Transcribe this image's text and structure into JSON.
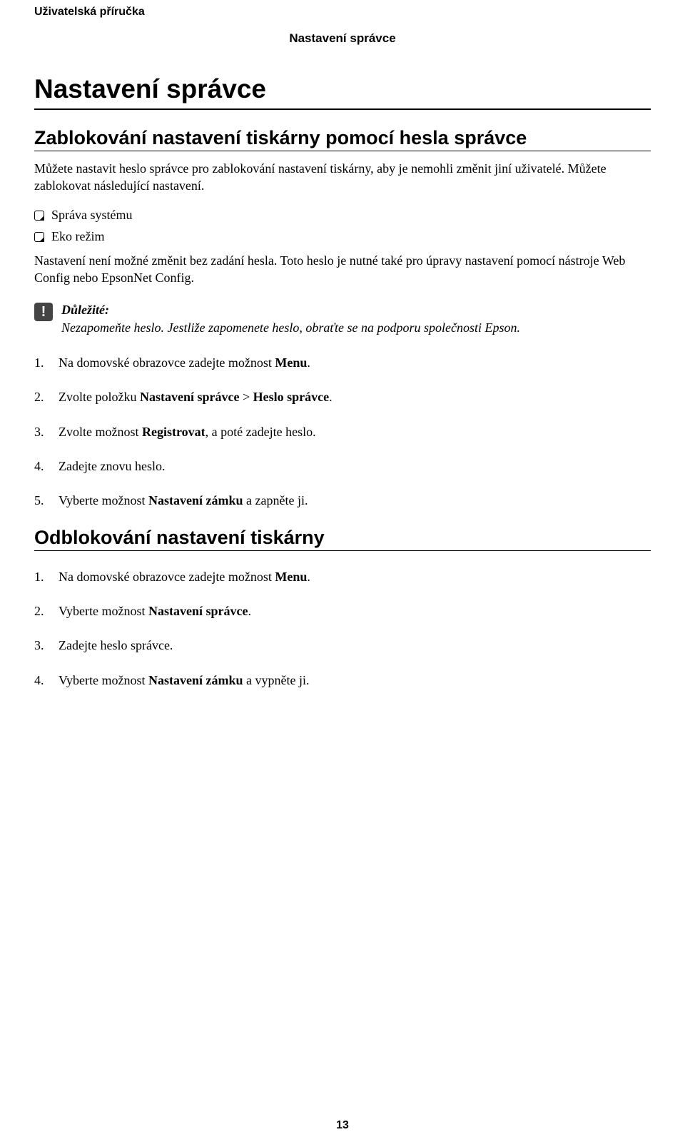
{
  "doc_title": "Uživatelská příručka",
  "breadcrumb": "Nastavení správce",
  "h1": "Nastavení správce",
  "section_lock": {
    "heading": "Zablokování nastavení tiskárny pomocí hesla správce",
    "intro": "Můžete nastavit heslo správce pro zablokování nastavení tiskárny, aby je nemohli změnit jiní uživatelé. Můžete zablokovat následující nastavení.",
    "bullets": [
      "Správa systému",
      "Eko režim"
    ],
    "after_bullets": "Nastavení není možné změnit bez zadání hesla. Toto heslo je nutné také pro úpravy nastavení pomocí nástroje Web Config nebo EpsonNet Config.",
    "important_label": "Důležité:",
    "important_text": "Nezapomeňte heslo. Jestliže zapomenete heslo, obraťte se na podporu společnosti Epson.",
    "steps": [
      {
        "pre": "Na domovské obrazovce zadejte možnost ",
        "b1": "Menu",
        "post": "."
      },
      {
        "pre": "Zvolte položku ",
        "b1": "Nastavení správce",
        "mid": " > ",
        "b2": "Heslo správce",
        "post": "."
      },
      {
        "pre": "Zvolte možnost ",
        "b1": "Registrovat",
        "post": ", a poté zadejte heslo."
      },
      {
        "pre": "Zadejte znovu heslo.",
        "b1": "",
        "post": ""
      },
      {
        "pre": "Vyberte možnost ",
        "b1": "Nastavení zámku",
        "post": " a zapněte ji."
      }
    ]
  },
  "section_unlock": {
    "heading": "Odblokování nastavení tiskárny",
    "steps": [
      {
        "pre": "Na domovské obrazovce zadejte možnost ",
        "b1": "Menu",
        "post": "."
      },
      {
        "pre": "Vyberte možnost ",
        "b1": "Nastavení správce",
        "post": "."
      },
      {
        "pre": "Zadejte heslo správce.",
        "b1": "",
        "post": ""
      },
      {
        "pre": "Vyberte možnost ",
        "b1": "Nastavení zámku",
        "post": " a vypněte ji."
      }
    ]
  },
  "page_number": "13"
}
